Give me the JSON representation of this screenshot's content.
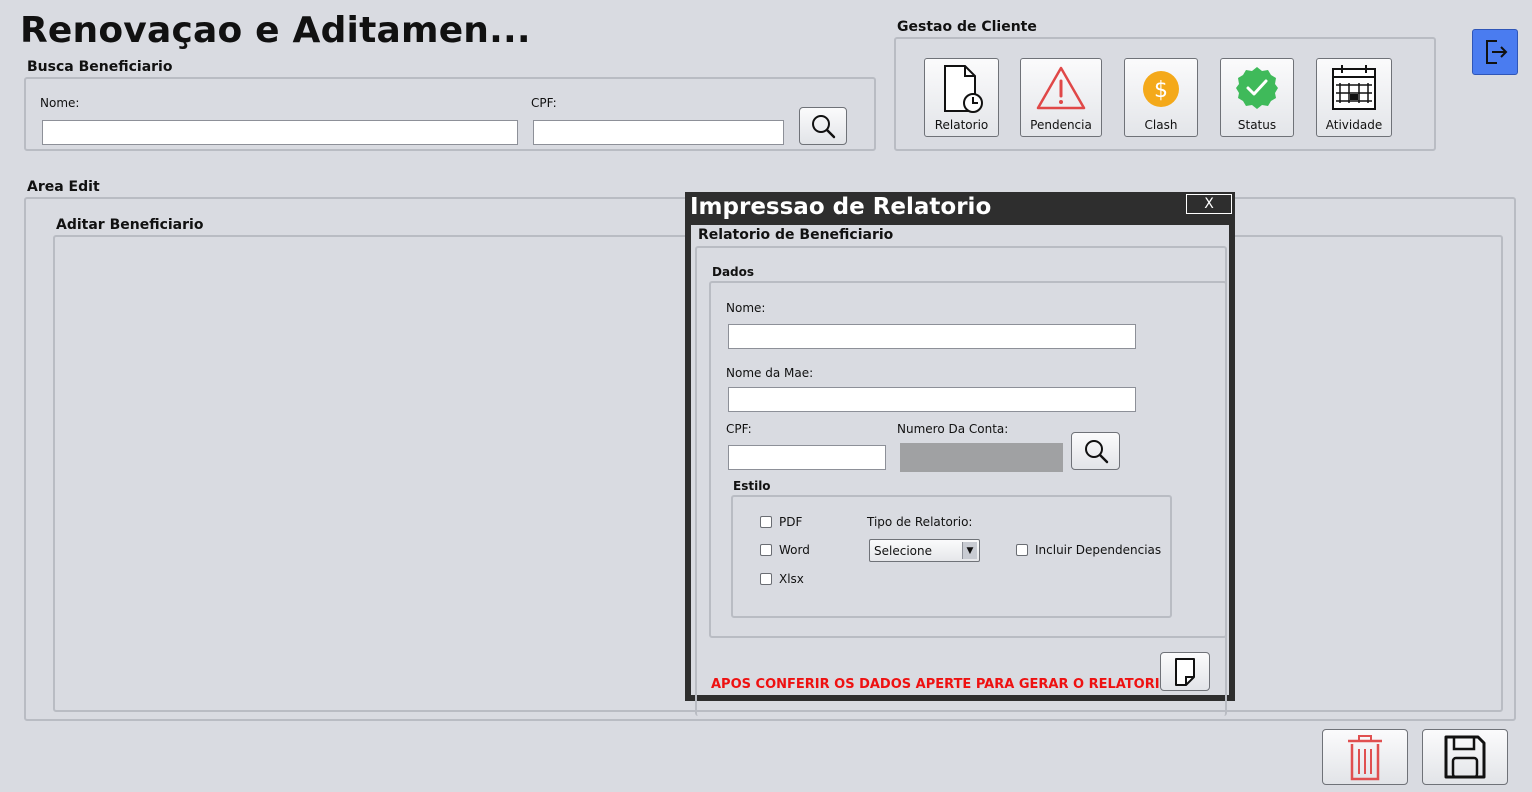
{
  "header": {
    "title": "Renovaçao e Aditamen..."
  },
  "busca": {
    "label": "Busca Beneficiario",
    "nome_label": "Nome:",
    "nome_value": "",
    "cpf_label": "CPF:",
    "cpf_value": ""
  },
  "gestao": {
    "label": "Gestao de Cliente",
    "tiles": [
      {
        "label": "Relatorio",
        "icon": "report-document-icon"
      },
      {
        "label": "Pendencia",
        "icon": "warning-icon"
      },
      {
        "label": "Clash",
        "icon": "dollar-coin-icon"
      },
      {
        "label": "Status",
        "icon": "check-badge-icon"
      },
      {
        "label": "Atividade",
        "icon": "calendar-icon"
      }
    ]
  },
  "area_edit": {
    "label": "Area Edit",
    "aditar_label": "Aditar Beneficiario"
  },
  "dialog": {
    "title": "Impressao de Relatorio",
    "close": "X",
    "section": "Relatorio de Beneficiario",
    "dados_label": "Dados",
    "nome_label": "Nome:",
    "nome_value": "",
    "mae_label": "Nome da Mae:",
    "mae_value": "",
    "cpf_label": "CPF:",
    "cpf_value": "",
    "conta_label": "Numero Da Conta:",
    "estilo_label": "Estilo",
    "options": [
      "PDF",
      "Word",
      "Xlsx"
    ],
    "tipo_label": "Tipo de Relatorio:",
    "tipo_selected": "Selecione",
    "incluir_label": "Incluir Dependencias",
    "warning": "APOS CONFERIR OS DADOS APERTE PARA GERAR O RELATORIO:"
  },
  "colors": {
    "background": "#d9dbe1",
    "dialog_frame": "#2e2e2e",
    "warning_text": "#ee1111",
    "logout_button": "#4a7cf0",
    "delete_icon": "#e05050"
  }
}
